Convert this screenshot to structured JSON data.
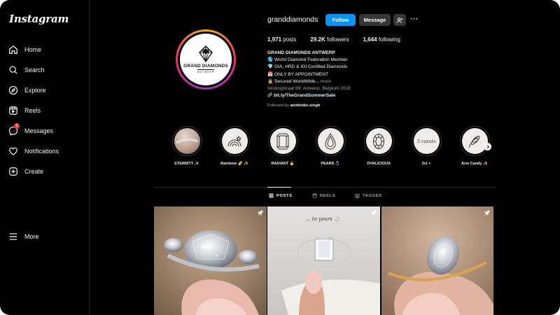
{
  "app": {
    "logo": "Instagram"
  },
  "sidebar": {
    "items": [
      {
        "label": "Home",
        "icon": "home-icon"
      },
      {
        "label": "Search",
        "icon": "search-icon"
      },
      {
        "label": "Explore",
        "icon": "compass-icon"
      },
      {
        "label": "Reels",
        "icon": "reels-icon"
      },
      {
        "label": "Messages",
        "icon": "messenger-icon",
        "badge": "1"
      },
      {
        "label": "Notifications",
        "icon": "heart-icon"
      },
      {
        "label": "Create",
        "icon": "plus-square-icon"
      }
    ],
    "more": {
      "label": "More",
      "icon": "menu-icon"
    }
  },
  "profile": {
    "username": "granddiamonds",
    "avatar": {
      "line1": "GRAND DIAMONDS",
      "line2": "ANTWERP"
    },
    "buttons": {
      "follow": "Follow",
      "message": "Message",
      "more": "···"
    },
    "stats": [
      {
        "value": "1,971",
        "label": "posts"
      },
      {
        "value": "29.2K",
        "label": "followers"
      },
      {
        "value": "1,644",
        "label": "following"
      }
    ],
    "bio": {
      "name": "GRAND DIAMONDS ANTWERP",
      "lines": [
        "🌎 World Diamond Federation Member",
        "💎 GIA, HRD & IGI Certified Diamonds",
        "📅 ONLY BY APPOINTMENT",
        "🔒 Secured WorldWide..."
      ],
      "more": "more",
      "address": "Vestingstraat 69, Antwerp, Belgium 2018",
      "link": "bit.ly/TheGrandSummerSale",
      "followed_by_prefix": "Followed by",
      "followed_by_user": "amitinder.singh"
    }
  },
  "highlights": [
    {
      "label": "ETERNITY ✨"
    },
    {
      "label": "Rainbow 🌈 ✨"
    },
    {
      "label": "RADIANT 🔥"
    },
    {
      "label": "PEARS 💍"
    },
    {
      "label": "OVALICIOUS"
    },
    {
      "label": "3ct +",
      "image_text": "3 carats"
    },
    {
      "label": "Arm Candy ✨"
    }
  ],
  "tabs": [
    {
      "label": "POSTS",
      "icon": "grid-icon",
      "active": true
    },
    {
      "label": "REELS",
      "icon": "reels-tab-icon",
      "active": false
    },
    {
      "label": "TAGGED",
      "icon": "tagged-icon",
      "active": false
    }
  ],
  "posts": [
    {
      "overlay_text": ""
    },
    {
      "overlay_text": "... to yours 💍"
    },
    {
      "overlay_text": ""
    }
  ],
  "colors": {
    "background": "#000000",
    "follow_button": "#0095f6",
    "secondary_button": "#363636",
    "badge": "#ff3040"
  }
}
